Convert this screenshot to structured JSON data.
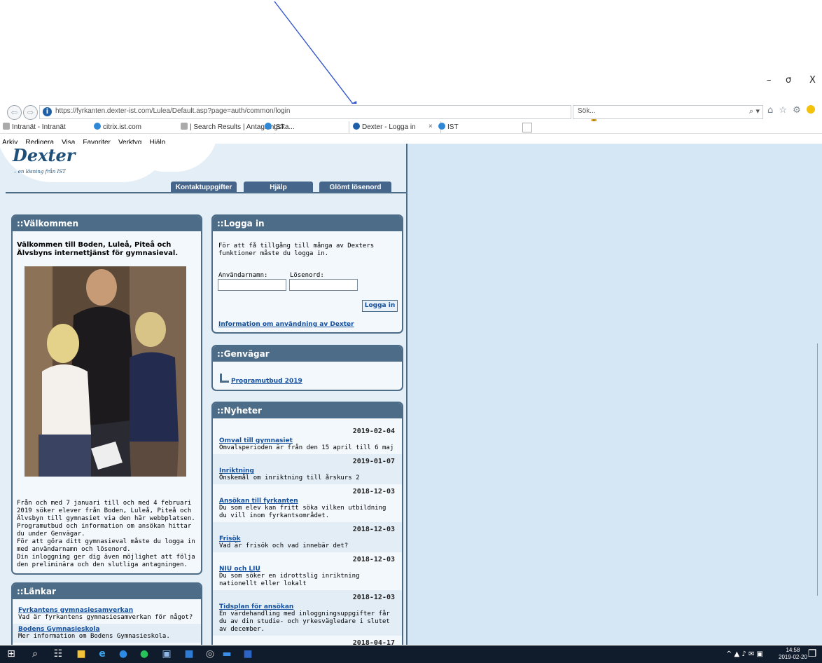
{
  "window": {
    "minimize": "–",
    "restore": "σ",
    "close": "X"
  },
  "browser": {
    "url": "https://fyrkanten.dexter-ist.com/Lulea/Default.asp?page=auth/common/login",
    "back_icon": "⇦",
    "forward_icon": "⇨",
    "addr_tools": "▾ 🔒 ↻",
    "search_placeholder": "Sök...",
    "search_icon": "⌕ ▾",
    "toolbar_icons": "⌂ ☆ ⚙",
    "tabs": [
      {
        "label": "Intranät - Intranät"
      },
      {
        "label": "citrix.ist.com"
      },
      {
        "label": "| Search Results | Antagningska..."
      },
      {
        "label": "IST"
      },
      {
        "label": "Dexter - Logga in"
      },
      {
        "label": "IST"
      }
    ],
    "tab_close": "×",
    "menu": [
      "Arkiv",
      "Redigera",
      "Visa",
      "Favoriter",
      "Verktyg",
      "Hjälp"
    ]
  },
  "header": {
    "logo_title": "Dexter",
    "logo_subtitle": "– en lösning från IST",
    "tabs": [
      "Kontaktuppgifter",
      "Hjälp",
      "Glömt lösenord"
    ]
  },
  "welcome": {
    "title": "::Välkommen",
    "intro": "Välkommen till Boden, Luleå, Piteå och Älvsbyns internettjänst för gymnasieval.",
    "paragraph": "Från och med 7 januari till och med 4 februari 2019 söker elever från Boden, Luleå, Piteå och Älvsbyn till gymnasiet via den här webbplatsen. Programutbud och information om ansökan hittar du under Genvägar.\nFör att göra ditt gymnasieval måste du logga in med användarnamn och lösenord.\nDin inloggning ger dig även möjlighet att följa den preliminära och den slutliga antagningen."
  },
  "links": {
    "title": "::Länkar",
    "items": [
      {
        "title": "Fyrkantens gymnasiesamverkan",
        "desc": "Vad är fyrkantens gymnasiesamverkan för något?"
      },
      {
        "title": "Bodens Gymnasieskola",
        "desc": "Mer information om Bodens Gymnasieskola."
      }
    ]
  },
  "login": {
    "title": "::Logga in",
    "intro": "För att få tillgång till många av Dexters funktioner måste du logga in.",
    "username_label": "Användarnamn:",
    "password_label": "Lösenord:",
    "username_value": "",
    "password_value": "",
    "button": "Logga in",
    "info_link": "Information om användning av Dexter"
  },
  "shortcuts": {
    "title": "::Genvägar",
    "items": [
      {
        "label": "Programutbud 2019"
      }
    ]
  },
  "news": {
    "title": "::Nyheter",
    "items": [
      {
        "date": "2019-02-04",
        "title": "Omval till gymnasiet",
        "desc": "Omvalsperioden är från den 15 april till 6 maj"
      },
      {
        "date": "2019-01-07",
        "title": "Inriktning",
        "desc": "Önskemål om inriktning till årskurs 2"
      },
      {
        "date": "2018-12-03",
        "title": "Ansökan till fyrkanten",
        "desc": "Du som elev kan fritt söka vilken utbildning du vill inom fyrkantsområdet."
      },
      {
        "date": "2018-12-03",
        "title": "Frisök",
        "desc": "Vad är frisök och vad innebär det?"
      },
      {
        "date": "2018-12-03",
        "title": "NIU och LIU",
        "desc": "Du som söker en idrottslig inriktning nationellt eller lokalt"
      },
      {
        "date": "2018-12-03",
        "title": "Tidsplan för ansökan",
        "desc": "En värdehandling med inloggningsuppgifter får du av din studie- och yrkesvägledare i slutet av december."
      },
      {
        "date": "2018-04-17",
        "title": "",
        "desc": ""
      }
    ]
  },
  "taskbar": {
    "tray": "^ ▲ ♪ ✉ ▣",
    "time": "14:58",
    "date": "2019-02-20"
  },
  "colors": {
    "header_blue": "#4d6c88",
    "link_blue": "#14509e",
    "page_bg": "#d5e7f5",
    "arrow": "#3355cc"
  }
}
